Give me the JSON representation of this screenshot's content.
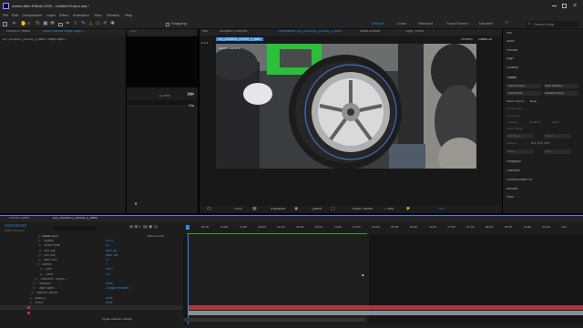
{
  "app": {
    "title": "Adobe After Effects 2020 - Untitled Project.aep *",
    "menu": [
      "File",
      "Edit",
      "Composition",
      "Layer",
      "Effect",
      "Animation",
      "View",
      "Window",
      "Help"
    ]
  },
  "toolbar": {
    "snapping_label": "Snapping",
    "workspaces": [
      "Default",
      "Learn",
      "Standard",
      "Small Screen",
      "Libraries"
    ],
    "search_placeholder": "Search Help"
  },
  "project_panel": {
    "tabs": [
      "Effects & Presets",
      "Effect Controls Shape Layer 1"
    ],
    "subtitle": "DJI_20200201_232516_0_video • Shape Layer 1"
  },
  "effects_panel": {
    "tab": "ETC",
    "count_label": "81 items",
    "list_header": "Sta",
    "list_items": [
      "01",
      "01",
      "01",
      "01",
      "01",
      "01",
      "01",
      "01",
      "01",
      "01"
    ]
  },
  "composition": {
    "tabs": [
      "Mat",
      "Animation Compose",
      "Composition: DJI_20200201_232516_0_video",
      "Media Browser",
      "Layer: Vimba"
    ],
    "breadcrumb": "DJI_20200201_232516_0_video",
    "renderer": "Renderer",
    "renderer_value": "Classic 3D",
    "overlay_label": "Active Camera",
    "zoom": "100%",
    "timecode": "0:00:00:00",
    "resolution": "Quarter",
    "camera": "Active Camera",
    "views": "1 View",
    "exposure": "+0.0",
    "side_label": "v 2.3"
  },
  "right_panel": {
    "items": [
      "Info",
      "Audio",
      "Preview",
      "Align",
      "Libraries",
      "Tracker"
    ],
    "tracker": {
      "track_camera": "Track Camera",
      "warp_stabilizer": "Warp Stabilizer",
      "track_motion": "Track Motion",
      "stabilize_motion": "Stabilize Motion",
      "motion_source_label": "Motion Source:",
      "motion_source_value": "None",
      "current_track_label": "Current Track:",
      "track_type_label": "Track Type:",
      "position": "Position",
      "rotation": "Rotation",
      "scale": "Scale",
      "motion_target": "Motion Target:",
      "edit_target": "Edit Target...",
      "options": "Options...",
      "analyze": "Analyze:",
      "reset": "Reset",
      "apply": "Apply"
    },
    "lower_items": [
      "Paragraph",
      "Character",
      "Content-Aware Fill",
      "Brushes",
      "Paint"
    ]
  },
  "timeline": {
    "tabs": [
      "Render Queue",
      "DJI_20200201_232516_0_video"
    ],
    "timecode": "0:00:00:00",
    "frame_info": "00000 (25.00 fps)",
    "source_header": "Source Name",
    "mode_header": "Parent & Link",
    "ruler": [
      "00:15f",
      "01:00f",
      "01:15f",
      "02:00f",
      "02:15f",
      "03:00f",
      "03:15f",
      "04:00f",
      "04:15f",
      "05:00f",
      "05:15f",
      "06:00f",
      "06:15f",
      "07:00f",
      "07:15f",
      "08:00f",
      "08:15f",
      "09:00f",
      "09:15f",
      "10:0"
    ],
    "rows": [
      {
        "indent": 12,
        "name": "Color",
        "value": ""
      },
      {
        "indent": 12,
        "name": "Opacity",
        "value": "100%"
      },
      {
        "indent": 12,
        "name": "Stroke Width",
        "value": "5.0"
      },
      {
        "indent": 12,
        "name": "Line Cap",
        "value": "Butt Cap"
      },
      {
        "indent": 12,
        "name": "Line Join",
        "value": "Miter Join"
      },
      {
        "indent": 12,
        "name": "Miter Limit",
        "value": "4.0"
      },
      {
        "indent": 10,
        "name": "Dashes",
        "value": "+ -"
      },
      {
        "indent": 14,
        "name": "Dash",
        "value": "500.0"
      },
      {
        "indent": 14,
        "name": "Offset",
        "value": "0.0"
      },
      {
        "indent": 8,
        "name": "Transform : Ellipse 1",
        "value": ""
      },
      {
        "indent": 6,
        "name": "Transform",
        "value": "Reset"
      },
      {
        "indent": 6,
        "name": "Layer Styles",
        "value": "Change Renderer..."
      },
      {
        "indent": 4,
        "name": "Material Options",
        "value": ""
      },
      {
        "indent": 2,
        "name": "[Black 2]",
        "value": "None"
      },
      {
        "indent": 2,
        "name": "Vimba",
        "value": "None"
      }
    ],
    "footer": "Toggle Switches / Modes"
  },
  "colors": {
    "accent": "#2d8ceb",
    "layer_red": "#a8393d",
    "work_area": "#3f9a3f"
  }
}
